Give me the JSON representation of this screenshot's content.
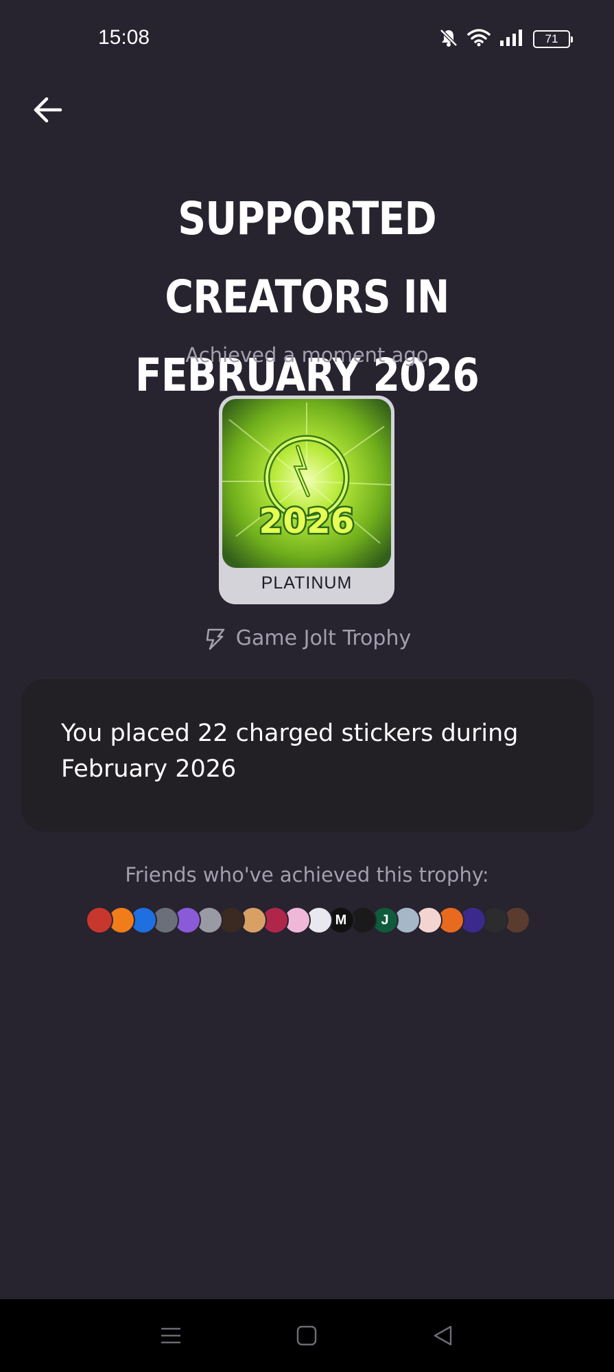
{
  "status_bar": {
    "time": "15:08",
    "battery": "71",
    "icons": [
      "bell-off-icon",
      "wifi-icon",
      "signal-icon",
      "battery-icon"
    ]
  },
  "header": {
    "back_icon": "arrow-left-icon"
  },
  "trophy": {
    "title": "SUPPORTED CREATORS IN FEBRUARY 2026",
    "achieved": "Achieved a moment ago",
    "art_text": "2026",
    "tier": "PLATINUM",
    "type": "Game Jolt Trophy",
    "description": "You placed 22 charged stickers during February 2026"
  },
  "friends": {
    "label": "Friends who've achieved this trophy:",
    "avatars": [
      {
        "color": "#c8372d",
        "text": ""
      },
      {
        "color": "#f07d1a",
        "text": ""
      },
      {
        "color": "#1e6fe0",
        "text": ""
      },
      {
        "color": "#6b6f7a",
        "text": ""
      },
      {
        "color": "#8a5bd6",
        "text": ""
      },
      {
        "color": "#9a9aa4",
        "text": ""
      },
      {
        "color": "#3a2a22",
        "text": ""
      },
      {
        "color": "#d9a066",
        "text": ""
      },
      {
        "color": "#b0264a",
        "text": ""
      },
      {
        "color": "#f0b8d8",
        "text": ""
      },
      {
        "color": "#e8e8ee",
        "text": ""
      },
      {
        "color": "#111111",
        "text": "M"
      },
      {
        "color": "#1a1a1a",
        "text": ""
      },
      {
        "color": "#0f5b3c",
        "text": "J"
      },
      {
        "color": "#a6b8c8",
        "text": ""
      },
      {
        "color": "#f3d4d0",
        "text": ""
      },
      {
        "color": "#e86a1e",
        "text": ""
      },
      {
        "color": "#3b2a8c",
        "text": ""
      },
      {
        "color": "#2c2c2c",
        "text": ""
      },
      {
        "color": "#5a3b2e",
        "text": ""
      }
    ]
  },
  "colors": {
    "background": "#27232f",
    "card": "#221f25",
    "muted_text": "#a49fae",
    "tier_badge": "#d4d3d9"
  },
  "nav_bar": {
    "icons": [
      "menu-icon",
      "home-square-icon",
      "back-triangle-icon"
    ]
  }
}
